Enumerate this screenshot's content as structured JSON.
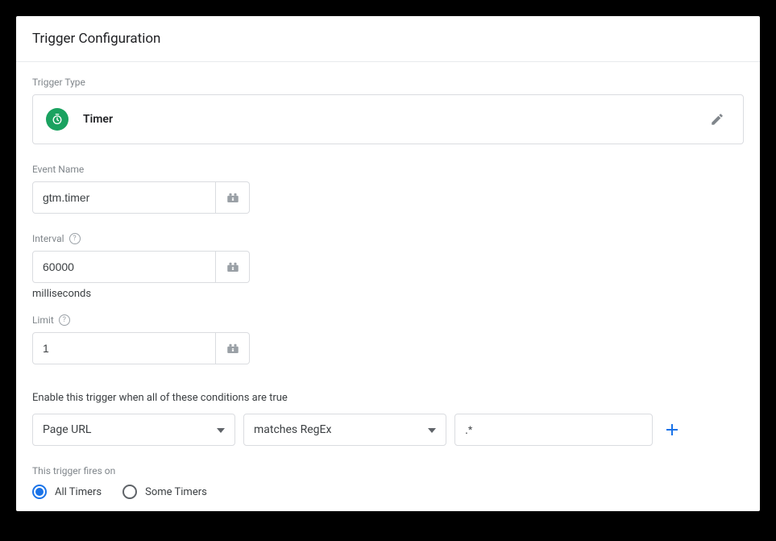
{
  "header": {
    "title": "Trigger Configuration"
  },
  "triggerType": {
    "label": "Trigger Type",
    "name": "Timer"
  },
  "eventName": {
    "label": "Event Name",
    "value": "gtm.timer"
  },
  "interval": {
    "label": "Interval",
    "value": "60000",
    "unit": "milliseconds"
  },
  "limit": {
    "label": "Limit",
    "value": "1"
  },
  "conditions": {
    "label": "Enable this trigger when all of these conditions are true",
    "rows": [
      {
        "variable": "Page URL",
        "operator": "matches RegEx",
        "value": ".*"
      }
    ]
  },
  "firesOn": {
    "label": "This trigger fires on",
    "options": [
      {
        "label": "All Timers",
        "checked": true
      },
      {
        "label": "Some Timers",
        "checked": false
      }
    ]
  }
}
